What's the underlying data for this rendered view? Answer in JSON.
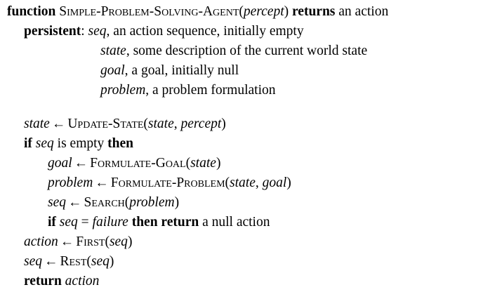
{
  "header": {
    "kw_function": "function",
    "name": "Simple-Problem-Solving-Agent",
    "paren_open": "(",
    "param": "percept",
    "paren_close": ")",
    "kw_returns": "returns",
    "rest": " an action"
  },
  "persistent": {
    "kw": "persistent",
    "colon": ":",
    "vars": [
      {
        "name": "seq",
        "desc": ", an action sequence, initially empty"
      },
      {
        "name": "state",
        "desc": ", some description of the current world state"
      },
      {
        "name": "goal",
        "desc": ", a goal, initially null"
      },
      {
        "name": "problem",
        "desc": ", a problem formulation"
      }
    ]
  },
  "symbols": {
    "arrow": "←"
  },
  "body": {
    "l1": {
      "lhs": "state",
      "fn": "Update-State",
      "open": "(",
      "a1": "state",
      "comma": ", ",
      "a2": "percept",
      "close": ")"
    },
    "l2": {
      "kw_if": "if",
      "var": "seq",
      "mid": " is empty ",
      "kw_then": "then"
    },
    "l3": {
      "lhs": "goal",
      "fn": "Formulate-Goal",
      "open": "(",
      "a1": "state",
      "close": ")"
    },
    "l4": {
      "lhs": "problem",
      "fn": "Formulate-Problem",
      "open": "(",
      "a1": "state",
      "comma": ", ",
      "a2": "goal",
      "close": ")"
    },
    "l5": {
      "lhs": "seq",
      "fn": "Search",
      "open": "(",
      "a1": "problem",
      "close": ")"
    },
    "l6": {
      "kw_if": "if",
      "var": "seq",
      "eq": " = ",
      "val": "failure",
      "kw_then": "then",
      "kw_return": "return",
      "rest": " a null action"
    },
    "l7": {
      "lhs": "action",
      "fn": "First",
      "open": "(",
      "a1": "seq",
      "close": ")"
    },
    "l8": {
      "lhs": "seq",
      "fn": "Rest",
      "open": "(",
      "a1": "seq",
      "close": ")"
    },
    "l9": {
      "kw_return": "return",
      "var": "action"
    }
  }
}
